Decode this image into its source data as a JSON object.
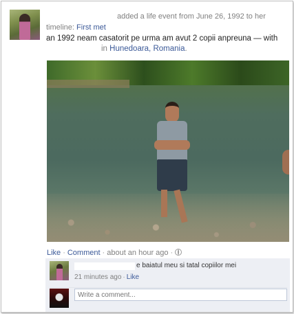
{
  "post": {
    "action_text": "added a life event from June 26, 1992 to her",
    "timeline_prefix": "timeline:",
    "event_link": "First met",
    "description": "an 1992 neam casatorit pe urma am avut 2 copii anpreuna — with",
    "location_prefix": "in",
    "location_link": "Hunedoara, Romania",
    "location_suffix": "."
  },
  "actions": {
    "like": "Like",
    "comment": "Comment",
    "time": "about an hour ago"
  },
  "comment": {
    "text": "e baiatul meu si tatal copiilor mei",
    "time": "21 minutes ago",
    "like": "Like"
  },
  "composer": {
    "placeholder": "Write a comment..."
  },
  "colors": {
    "link": "#3b5998",
    "comment_bg": "#edeff4",
    "muted": "#808080"
  }
}
